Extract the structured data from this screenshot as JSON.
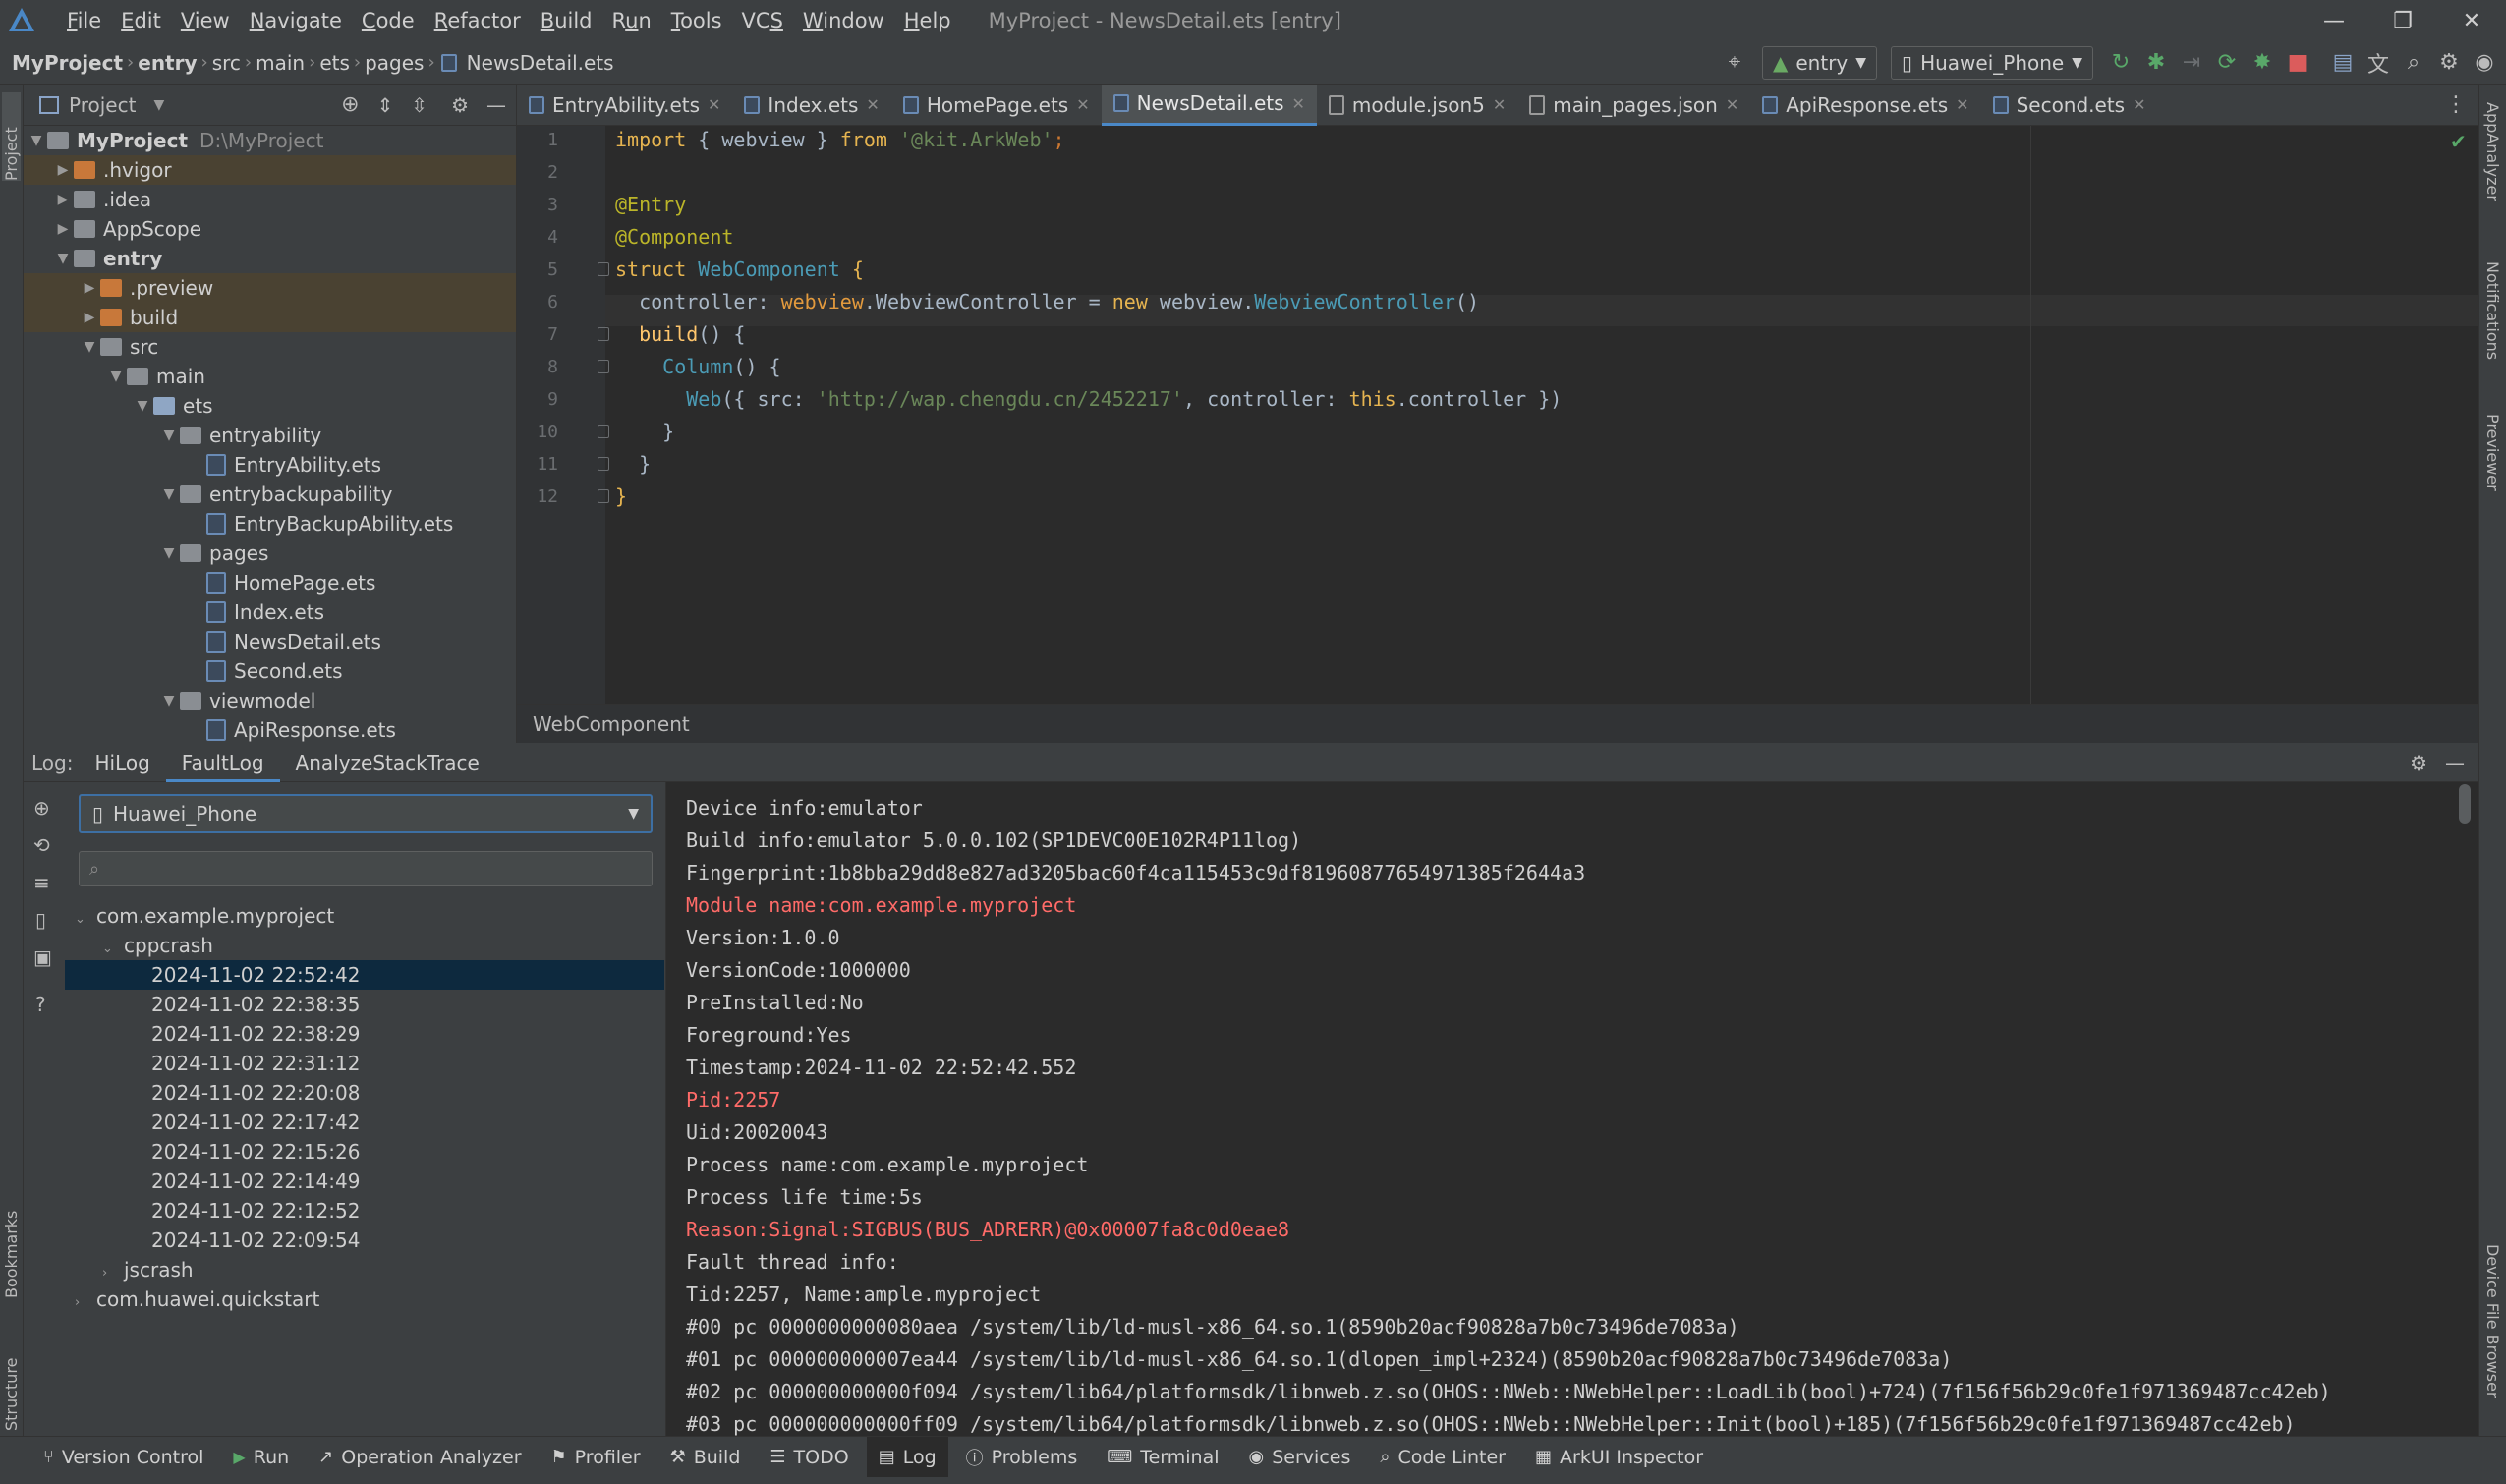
{
  "app": {
    "title": "MyProject - NewsDetail.ets [entry]",
    "menu": [
      {
        "pre": "",
        "u": "F",
        "post": "ile"
      },
      {
        "pre": "",
        "u": "E",
        "post": "dit"
      },
      {
        "pre": "",
        "u": "V",
        "post": "iew"
      },
      {
        "pre": "",
        "u": "N",
        "post": "avigate"
      },
      {
        "pre": "",
        "u": "C",
        "post": "ode"
      },
      {
        "pre": "",
        "u": "R",
        "post": "efactor"
      },
      {
        "pre": "",
        "u": "B",
        "post": "uild"
      },
      {
        "pre": "R",
        "u": "u",
        "post": "n"
      },
      {
        "pre": "",
        "u": "T",
        "post": "ools"
      },
      {
        "pre": "VC",
        "u": "S",
        "post": ""
      },
      {
        "pre": "",
        "u": "W",
        "post": "indow"
      },
      {
        "pre": "",
        "u": "H",
        "post": "elp"
      }
    ]
  },
  "navbar": {
    "breadcrumbs": [
      "MyProject",
      "entry",
      "src",
      "main",
      "ets",
      "pages",
      "NewsDetail.ets"
    ],
    "module_combo": "entry",
    "device_combo": "Huawei_Phone"
  },
  "project_panel": {
    "title": "Project",
    "tree": [
      {
        "label": "MyProject",
        "hint": "D:\\MyProject",
        "indent": 0,
        "arrow": "▼",
        "icon": "folder-grey",
        "bold": true
      },
      {
        "label": ".hvigor",
        "indent": 1,
        "arrow": "▶",
        "icon": "folder-orange",
        "excluded": true
      },
      {
        "label": ".idea",
        "indent": 1,
        "arrow": "▶",
        "icon": "folder-grey"
      },
      {
        "label": "AppScope",
        "indent": 1,
        "arrow": "▶",
        "icon": "folder-grey"
      },
      {
        "label": "entry",
        "indent": 1,
        "arrow": "▼",
        "icon": "folder-grey",
        "bold": true
      },
      {
        "label": ".preview",
        "indent": 2,
        "arrow": "▶",
        "icon": "folder-orange",
        "excluded": true
      },
      {
        "label": "build",
        "indent": 2,
        "arrow": "▶",
        "icon": "folder-orange",
        "excluded": true
      },
      {
        "label": "src",
        "indent": 2,
        "arrow": "▼",
        "icon": "folder-grey"
      },
      {
        "label": "main",
        "indent": 3,
        "arrow": "▼",
        "icon": "folder-grey"
      },
      {
        "label": "ets",
        "indent": 4,
        "arrow": "▼",
        "icon": "folder-blue"
      },
      {
        "label": "entryability",
        "indent": 5,
        "arrow": "▼",
        "icon": "folder-grey"
      },
      {
        "label": "EntryAbility.ets",
        "indent": 6,
        "arrow": "",
        "icon": "file"
      },
      {
        "label": "entrybackupability",
        "indent": 5,
        "arrow": "▼",
        "icon": "folder-grey"
      },
      {
        "label": "EntryBackupAbility.ets",
        "indent": 6,
        "arrow": "",
        "icon": "file"
      },
      {
        "label": "pages",
        "indent": 5,
        "arrow": "▼",
        "icon": "folder-grey"
      },
      {
        "label": "HomePage.ets",
        "indent": 6,
        "arrow": "",
        "icon": "file"
      },
      {
        "label": "Index.ets",
        "indent": 6,
        "arrow": "",
        "icon": "file"
      },
      {
        "label": "NewsDetail.ets",
        "indent": 6,
        "arrow": "",
        "icon": "file"
      },
      {
        "label": "Second.ets",
        "indent": 6,
        "arrow": "",
        "icon": "file"
      },
      {
        "label": "viewmodel",
        "indent": 5,
        "arrow": "▼",
        "icon": "folder-grey"
      },
      {
        "label": "ApiResponse.ets",
        "indent": 6,
        "arrow": "",
        "icon": "file"
      }
    ]
  },
  "editor_tabs": [
    {
      "label": "EntryAbility.ets",
      "active": false
    },
    {
      "label": "Index.ets",
      "active": false
    },
    {
      "label": "HomePage.ets",
      "active": false
    },
    {
      "label": "NewsDetail.ets",
      "active": true
    },
    {
      "label": "module.json5",
      "active": false
    },
    {
      "label": "main_pages.json",
      "active": false
    },
    {
      "label": "ApiResponse.ets",
      "active": false
    },
    {
      "label": "Second.ets",
      "active": false
    }
  ],
  "editor": {
    "line_numbers": [
      "1",
      "2",
      "3",
      "4",
      "5",
      "6",
      "7",
      "8",
      "9",
      "10",
      "11",
      "12"
    ],
    "code": {
      "l1_import": "import",
      "l1_mid": " { webview } ",
      "l1_from": "from",
      "l1_str": " '@kit.ArkWeb'",
      "l1_end": ";",
      "l3": "@Entry",
      "l4": "@Component",
      "l5_struct": "struct",
      "l5_name": " WebComponent ",
      "l5_brace": "{",
      "l6_name": "  controller: ",
      "l6_type": "webview",
      "l6_mid": ".WebviewController = ",
      "l6_new": "new",
      "l6_mid2": " webview.",
      "l6_cls": "WebviewController",
      "l6_end": "()",
      "l7_fn": "  build",
      "l7_end": "() {",
      "l8_fn": "    Column",
      "l8_end": "() {",
      "l9_fn": "      Web",
      "l9_a": "({ src: ",
      "l9_str": "'http://wap.chengdu.cn/2452217'",
      "l9_b": ", controller: ",
      "l9_this": "this",
      "l9_c": ".controller })",
      "l10": "    }",
      "l11": "  }",
      "l12": "}"
    },
    "breadcrumb": "WebComponent"
  },
  "log_panel": {
    "label": "Log:",
    "tabs": [
      "HiLog",
      "FaultLog",
      "AnalyzeStackTrace"
    ],
    "active_tab": "FaultLog",
    "device": "Huawei_Phone",
    "search_placeholder": "",
    "tree": {
      "app": "com.example.myproject",
      "group": "cppcrash",
      "entries": [
        "2024-11-02 22:52:42",
        "2024-11-02 22:38:35",
        "2024-11-02 22:38:29",
        "2024-11-02 22:31:12",
        "2024-11-02 22:20:08",
        "2024-11-02 22:17:42",
        "2024-11-02 22:15:26",
        "2024-11-02 22:14:49",
        "2024-11-02 22:12:52",
        "2024-11-02 22:09:54"
      ],
      "jscrash": "jscrash",
      "other_app": "com.huawei.quickstart"
    },
    "lines": [
      {
        "text": "Device info:emulator",
        "err": false
      },
      {
        "text": "Build info:emulator 5.0.0.102(SP1DEVC00E102R4P11log)",
        "err": false
      },
      {
        "text": "Fingerprint:1b8bba29dd8e827ad3205bac60f4ca115453c9df81960877654971385f2644a3",
        "err": false
      },
      {
        "text": "Module name:com.example.myproject",
        "err": true
      },
      {
        "text": "Version:1.0.0",
        "err": false
      },
      {
        "text": "VersionCode:1000000",
        "err": false
      },
      {
        "text": "PreInstalled:No",
        "err": false
      },
      {
        "text": "Foreground:Yes",
        "err": false
      },
      {
        "text": "Timestamp:2024-11-02 22:52:42.552",
        "err": false
      },
      {
        "text": "Pid:2257",
        "err": true
      },
      {
        "text": "Uid:20020043",
        "err": false
      },
      {
        "text": "Process name:com.example.myproject",
        "err": false
      },
      {
        "text": "Process life time:5s",
        "err": false
      },
      {
        "text": "Reason:Signal:SIGBUS(BUS_ADRERR)@0x00007fa8c0d0eae8",
        "err": true
      },
      {
        "text": "Fault thread info:",
        "err": false
      },
      {
        "text": "Tid:2257, Name:ample.myproject",
        "err": false
      },
      {
        "text": "#00 pc 0000000000080aea /system/lib/ld-musl-x86_64.so.1(8590b20acf90828a7b0c73496de7083a)",
        "err": false
      },
      {
        "text": "#01 pc 000000000007ea44 /system/lib/ld-musl-x86_64.so.1(dlopen_impl+2324)(8590b20acf90828a7b0c73496de7083a)",
        "err": false
      },
      {
        "text": "#02 pc 000000000000f094 /system/lib64/platformsdk/libnweb.z.so(OHOS::NWeb::NWebHelper::LoadLib(bool)+724)(7f156f56b29c0fe1f971369487cc42eb)",
        "err": false
      },
      {
        "text": "#03 pc 000000000000ff09 /system/lib64/platformsdk/libnweb.z.so(OHOS::NWeb::NWebHelper::Init(bool)+185)(7f156f56b29c0fe1f971369487cc42eb)",
        "err": false
      }
    ]
  },
  "side_labels": {
    "left": [
      "Project",
      "Bookmarks",
      "Structure"
    ],
    "right": [
      "AppAnalyzer",
      "Notifications",
      "Previewer",
      "Device File Browser"
    ]
  },
  "bottom_bar": [
    {
      "label": "Version Control",
      "icon": "branch-icon",
      "active": false
    },
    {
      "label": "Run",
      "icon": "run-icon",
      "active": false
    },
    {
      "label": "Operation Analyzer",
      "icon": "chart-icon",
      "active": false
    },
    {
      "label": "Profiler",
      "icon": "profiler-icon",
      "active": false
    },
    {
      "label": "Build",
      "icon": "hammer-icon",
      "active": false
    },
    {
      "label": "TODO",
      "icon": "list-icon",
      "active": false
    },
    {
      "label": "Log",
      "icon": "log-icon",
      "active": true
    },
    {
      "label": "Problems",
      "icon": "info-icon",
      "active": false
    },
    {
      "label": "Terminal",
      "icon": "terminal-icon",
      "active": false
    },
    {
      "label": "Services",
      "icon": "services-icon",
      "active": false
    },
    {
      "label": "Code Linter",
      "icon": "linter-icon",
      "active": false
    },
    {
      "label": "ArkUI Inspector",
      "icon": "inspector-icon",
      "active": false
    }
  ],
  "colors": {
    "accent": "#4a88c7",
    "error_text": "#ff6b68",
    "selection": "#0d293e"
  }
}
